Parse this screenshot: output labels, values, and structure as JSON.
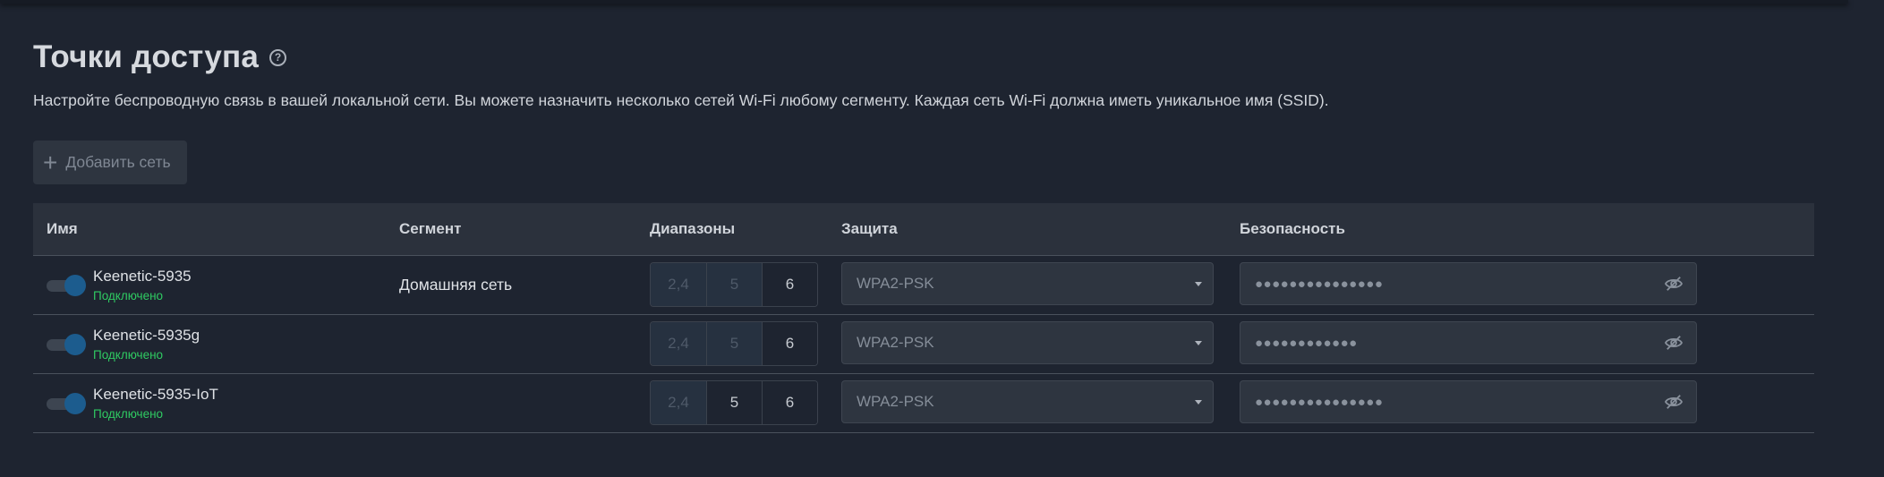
{
  "page": {
    "title": "Точки доступа",
    "help_icon": "?",
    "description": "Настройте беспроводную связь в вашей локальной сети. Вы можете назначить несколько сетей Wi-Fi любому сегменту. Каждая сеть Wi-Fi должна иметь уникальное имя (SSID).",
    "add_button": {
      "icon": "+",
      "label": "Добавить сеть"
    }
  },
  "table": {
    "headers": {
      "name": "Имя",
      "segment": "Сегмент",
      "bands": "Диапазоны",
      "security_type": "Защита",
      "password": "Безопасность"
    },
    "rows": [
      {
        "name": "Keenetic-5935",
        "status": "Подключено",
        "enabled": true,
        "segment": "Домашняя сеть",
        "bands": [
          {
            "label": "2,4",
            "active": true
          },
          {
            "label": "5",
            "active": true
          },
          {
            "label": "6",
            "active": false
          }
        ],
        "security": "WPA2-PSK",
        "password_mask": "●●●●●●●●●●●●●●●"
      },
      {
        "name": "Keenetic-5935g",
        "status": "Подключено",
        "enabled": true,
        "segment": "",
        "bands": [
          {
            "label": "2,4",
            "active": true
          },
          {
            "label": "5",
            "active": true
          },
          {
            "label": "6",
            "active": false
          }
        ],
        "security": "WPA2-PSK",
        "password_mask": "●●●●●●●●●●●●"
      },
      {
        "name": "Keenetic-5935-IoT",
        "status": "Подключено",
        "enabled": true,
        "segment": "",
        "bands": [
          {
            "label": "2,4",
            "active": true
          },
          {
            "label": "5",
            "active": false
          },
          {
            "label": "6",
            "active": false
          }
        ],
        "security": "WPA2-PSK",
        "password_mask": "●●●●●●●●●●●●●●●"
      }
    ]
  },
  "icons": {
    "eye": "eye-slash-icon",
    "caret": "chevron-down-icon",
    "help": "question-circle-icon"
  },
  "colors": {
    "accent": "#1c5c8e",
    "status_ok": "#2fcb62",
    "background": "#1e2430"
  }
}
